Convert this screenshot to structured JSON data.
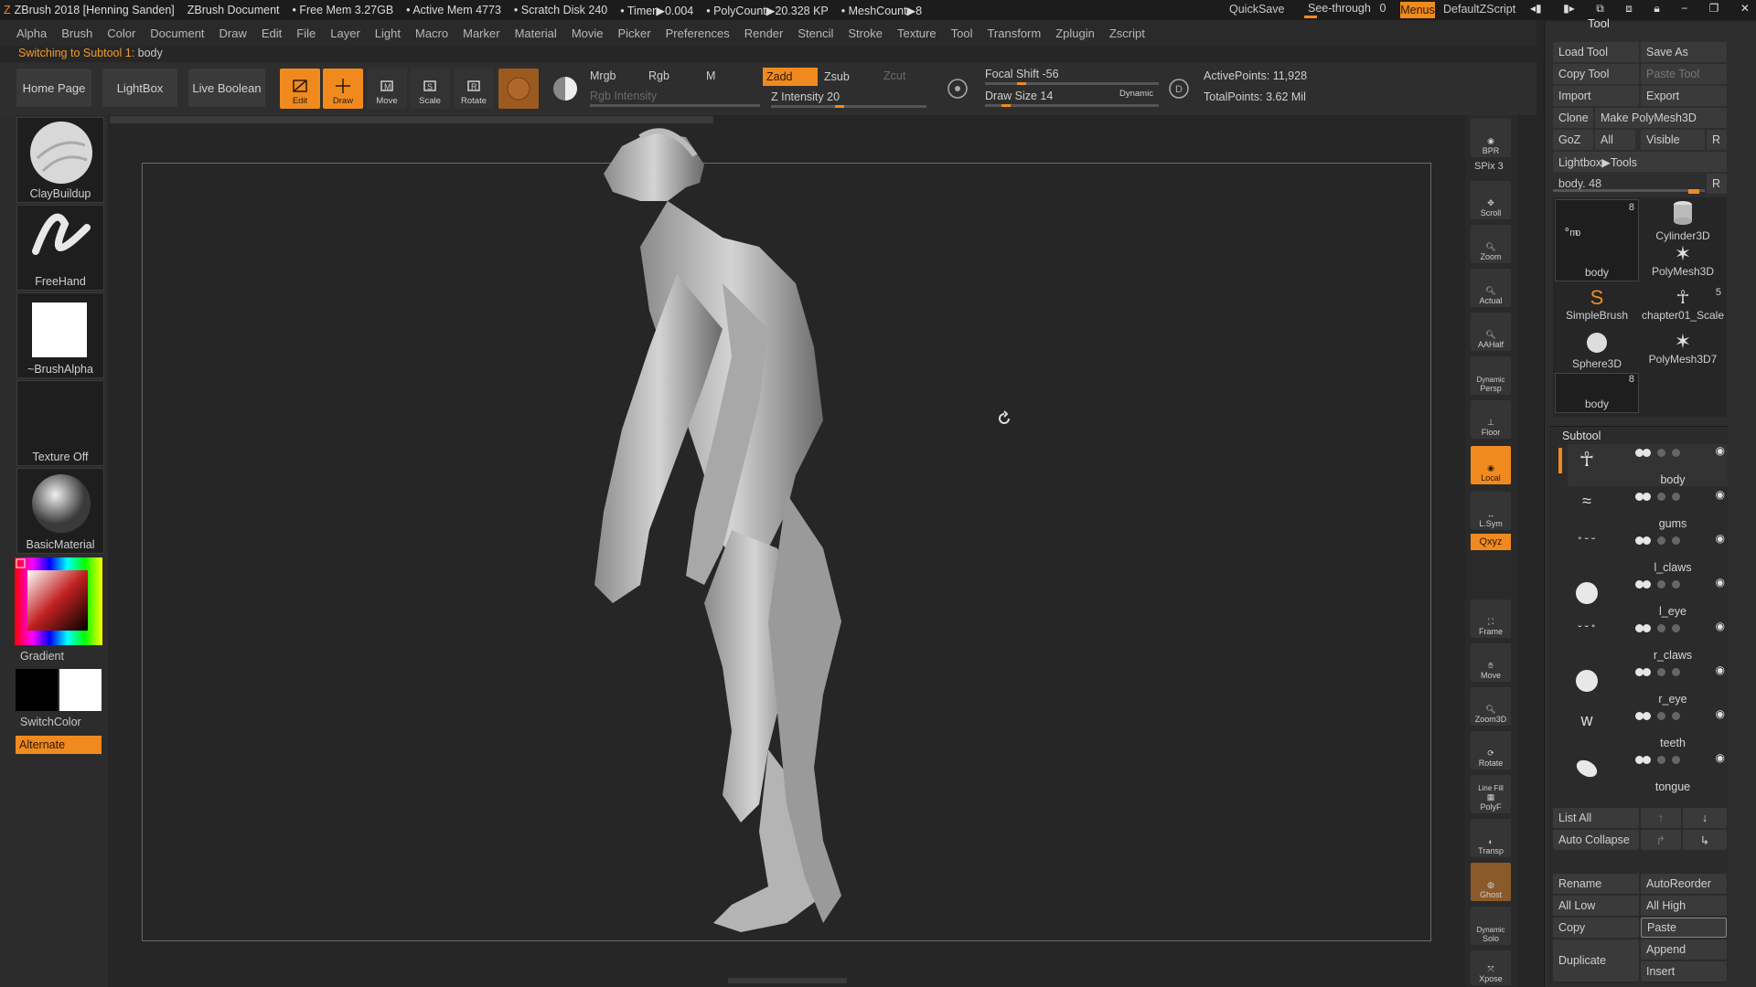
{
  "titlebar": {
    "app": "ZBrush 2018 [Henning Sanden]",
    "document": "ZBrush Document",
    "free_mem": "• Free Mem 3.27GB",
    "active_mem": "• Active Mem 4773",
    "scratch": "• Scratch Disk 240",
    "timer": "• Timer▶0.004",
    "polycount": "• PolyCount▶20.328 KP",
    "meshcount": "• MeshCount▶8",
    "quicksave": "QuickSave",
    "seethrough": "See-through",
    "seethrough_value": "0",
    "menus": "Menus",
    "script": "DefaultZScript"
  },
  "menubar": [
    "Alpha",
    "Brush",
    "Color",
    "Document",
    "Draw",
    "Edit",
    "File",
    "Layer",
    "Light",
    "Macro",
    "Marker",
    "Material",
    "Movie",
    "Picker",
    "Preferences",
    "Render",
    "Stencil",
    "Stroke",
    "Texture",
    "Tool",
    "Transform",
    "Zplugin",
    "Zscript"
  ],
  "notice": {
    "prefix": "Switching to Subtool 1:",
    "value": "body"
  },
  "toolbar": {
    "home": "Home Page",
    "lightbox": "LightBox",
    "liveboolean": "Live Boolean",
    "edit": "Edit",
    "draw": "Draw",
    "move": "Move",
    "scale": "Scale",
    "rotate": "Rotate",
    "mrgb": "Mrgb",
    "rgb": "Rgb",
    "m": "M",
    "zadd": "Zadd",
    "zsub": "Zsub",
    "zcut": "Zcut",
    "rgb_intensity": "Rgb Intensity",
    "z_intensity": "Z Intensity 20",
    "focal_shift": "Focal Shift -56",
    "draw_size": "Draw Size 14",
    "dynamic": "Dynamic",
    "active_points": "ActivePoints: 11,928",
    "total_points": "TotalPoints: 3.62 Mil"
  },
  "left": {
    "brush": "ClayBuildup",
    "stroke": "FreeHand",
    "alpha": "~BrushAlpha",
    "texture": "Texture Off",
    "material": "BasicMaterial",
    "gradient": "Gradient",
    "switchcolor": "SwitchColor",
    "alternate": "Alternate"
  },
  "rightbar": {
    "bpr": "BPR",
    "spix": "SPix 3",
    "scroll": "Scroll",
    "zoom": "Zoom",
    "actual": "Actual",
    "aahalf": "AAHalf",
    "dynamic": "Dynamic",
    "persp": "Persp",
    "floor": "Floor",
    "local": "Local",
    "lsym": "L.Sym",
    "xyz": "Qxyz",
    "frame": "Frame",
    "move": "Move",
    "zoom3d": "Zoom3D",
    "rotate": "Rotate",
    "linefill": "Line Fill",
    "polyf": "PolyF",
    "transp": "Transp",
    "ghost": "Ghost",
    "dynamic2": "Dynamic",
    "solo": "Solo",
    "xpose": "Xpose"
  },
  "toolpanel": {
    "title": "Tool",
    "load": "Load Tool",
    "saveas": "Save As",
    "copy": "Copy Tool",
    "paste": "Paste Tool",
    "import": "Import",
    "export": "Export",
    "clone": "Clone",
    "makepoly": "Make PolyMesh3D",
    "goz": "GoZ",
    "all": "All",
    "visible": "Visible",
    "r": "R",
    "lightbox_tools": "Lightbox▶Tools",
    "body_slider": "body. 48",
    "tools": [
      {
        "name": "body",
        "count": "8"
      },
      {
        "name": "Cylinder3D",
        "count": ""
      },
      {
        "name": "PolyMesh3D",
        "count": ""
      },
      {
        "name": "SimpleBrush",
        "count": ""
      },
      {
        "name": "chapter01_Scale",
        "count": "5"
      },
      {
        "name": "Sphere3D",
        "count": ""
      },
      {
        "name": "PolyMesh3D7",
        "count": ""
      },
      {
        "name": "body",
        "count": "8"
      }
    ],
    "subtool_title": "Subtool",
    "subtools": [
      "body",
      "gums",
      "l_claws",
      "l_eye",
      "r_claws",
      "r_eye",
      "teeth",
      "tongue"
    ],
    "listall": "List All",
    "autocollapse": "Auto Collapse",
    "rename": "Rename",
    "autoreorder": "AutoReorder",
    "alllow": "All Low",
    "allhigh": "All High",
    "copy2": "Copy",
    "paste2": "Paste",
    "duplicate": "Duplicate",
    "append": "Append",
    "insert": "Insert"
  }
}
